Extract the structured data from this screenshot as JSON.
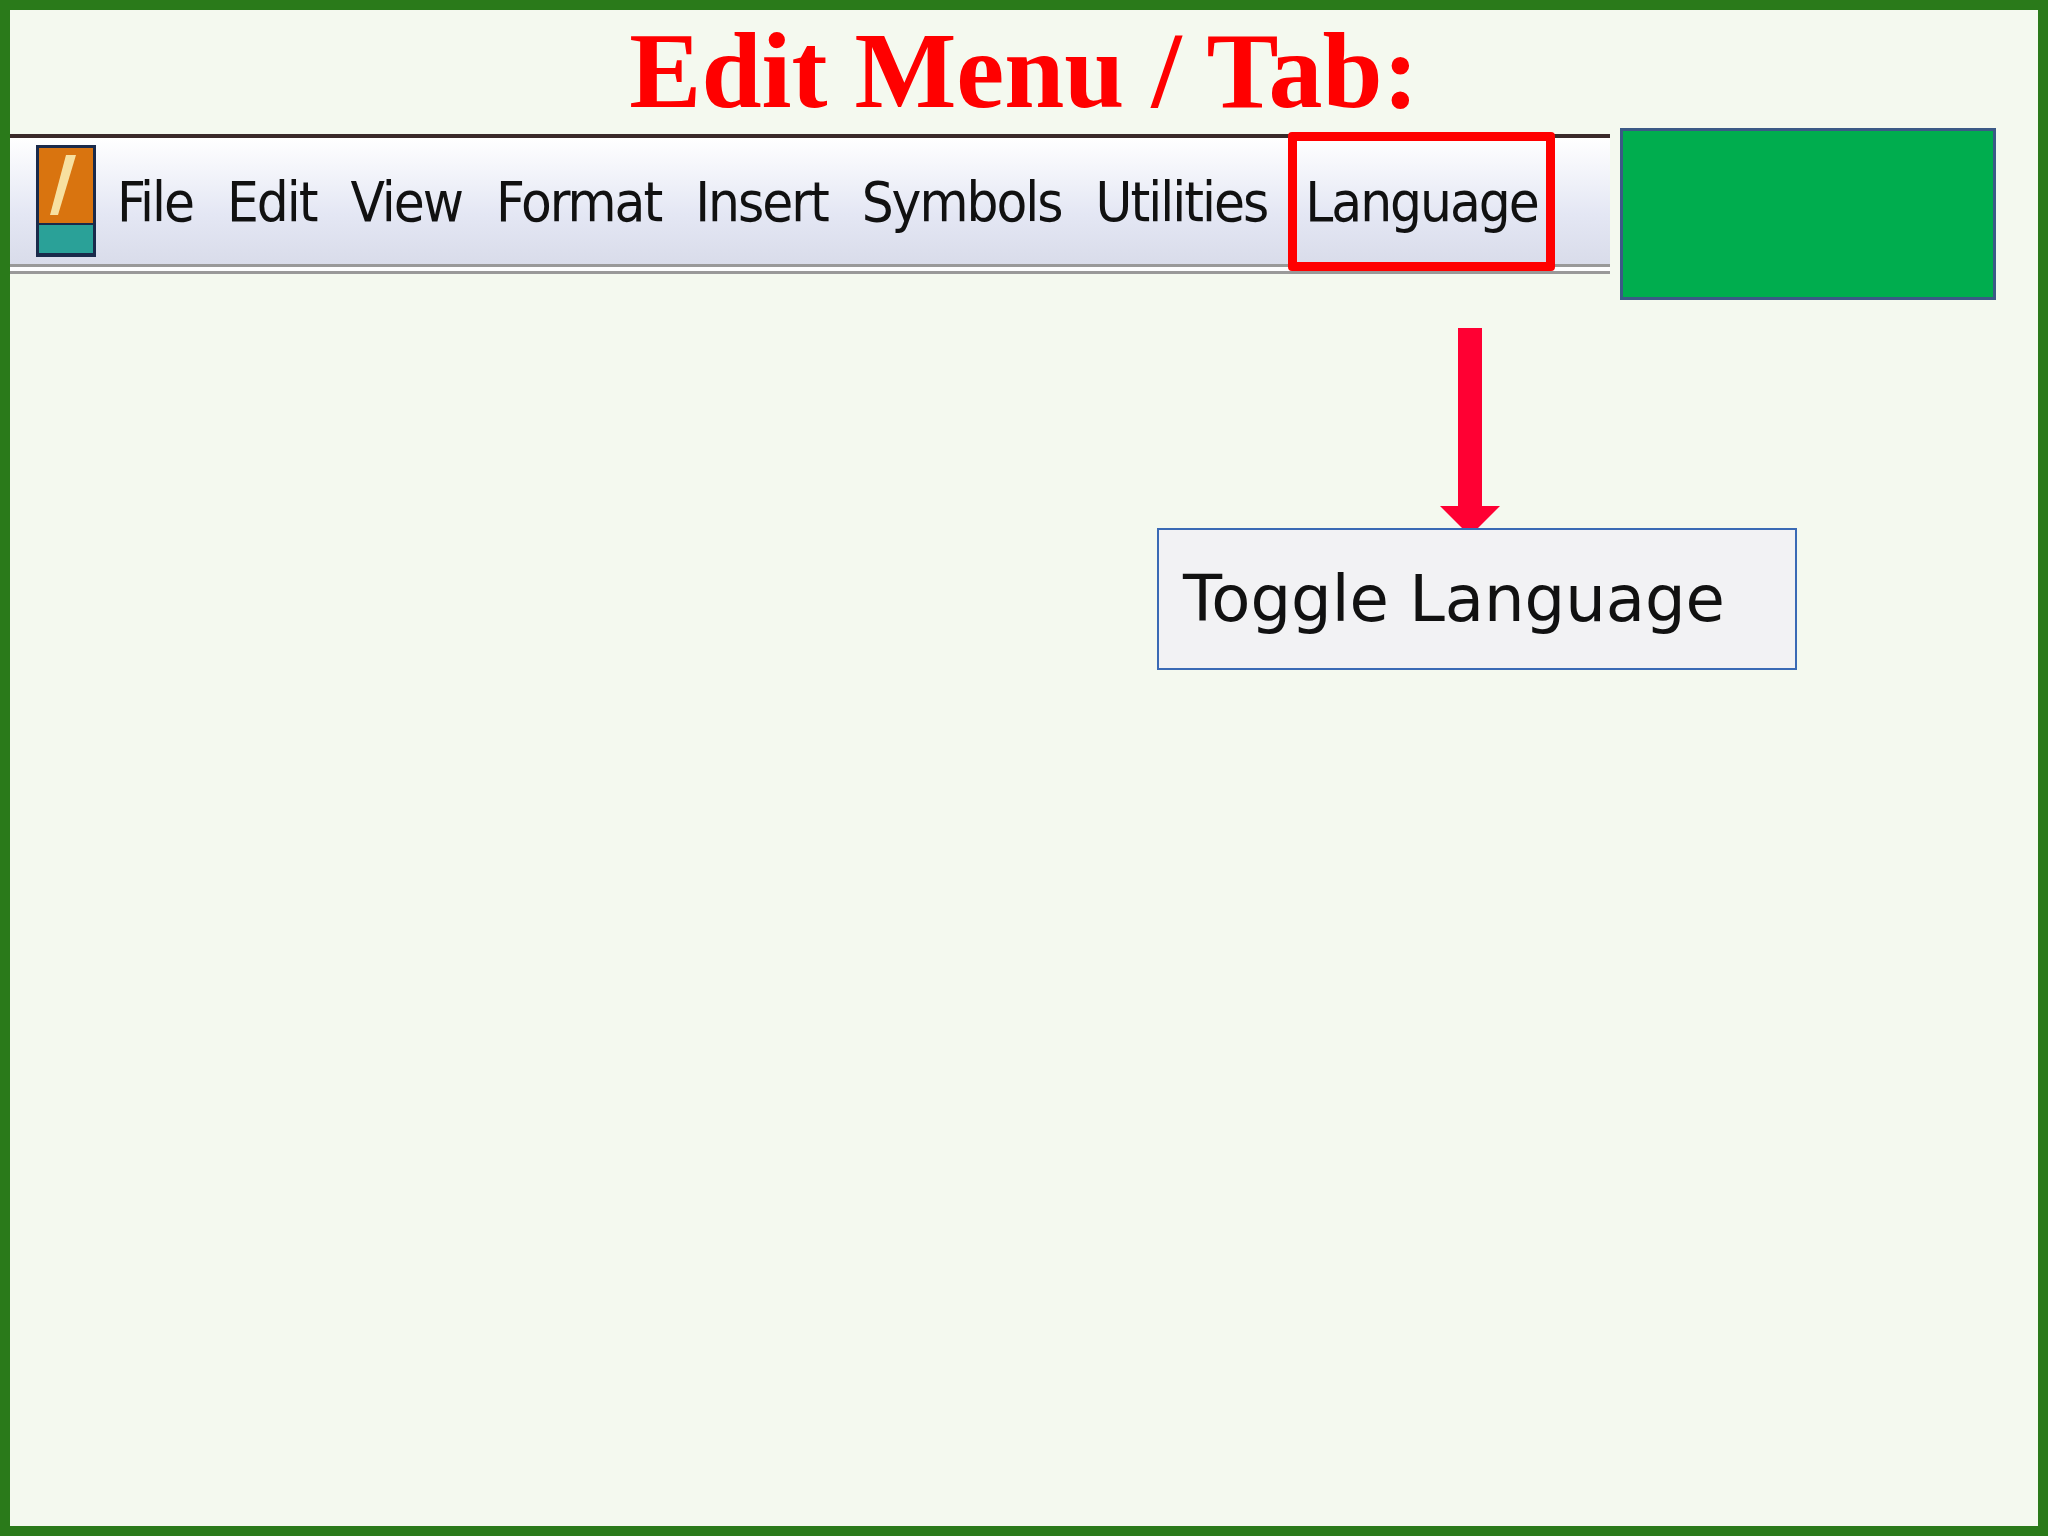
{
  "slide_title": "Edit Menu / Tab:",
  "menu_bar": {
    "items": [
      {
        "label": "File",
        "selected": false
      },
      {
        "label": "Edit",
        "selected": false
      },
      {
        "label": "View",
        "selected": false
      },
      {
        "label": "Format",
        "selected": false
      },
      {
        "label": "Insert",
        "selected": false
      },
      {
        "label": "Symbols",
        "selected": false
      },
      {
        "label": "Utilities",
        "selected": false
      },
      {
        "label": "Language",
        "selected": true
      }
    ]
  },
  "dropdown": {
    "items": [
      {
        "label": "Toggle Language"
      }
    ]
  }
}
